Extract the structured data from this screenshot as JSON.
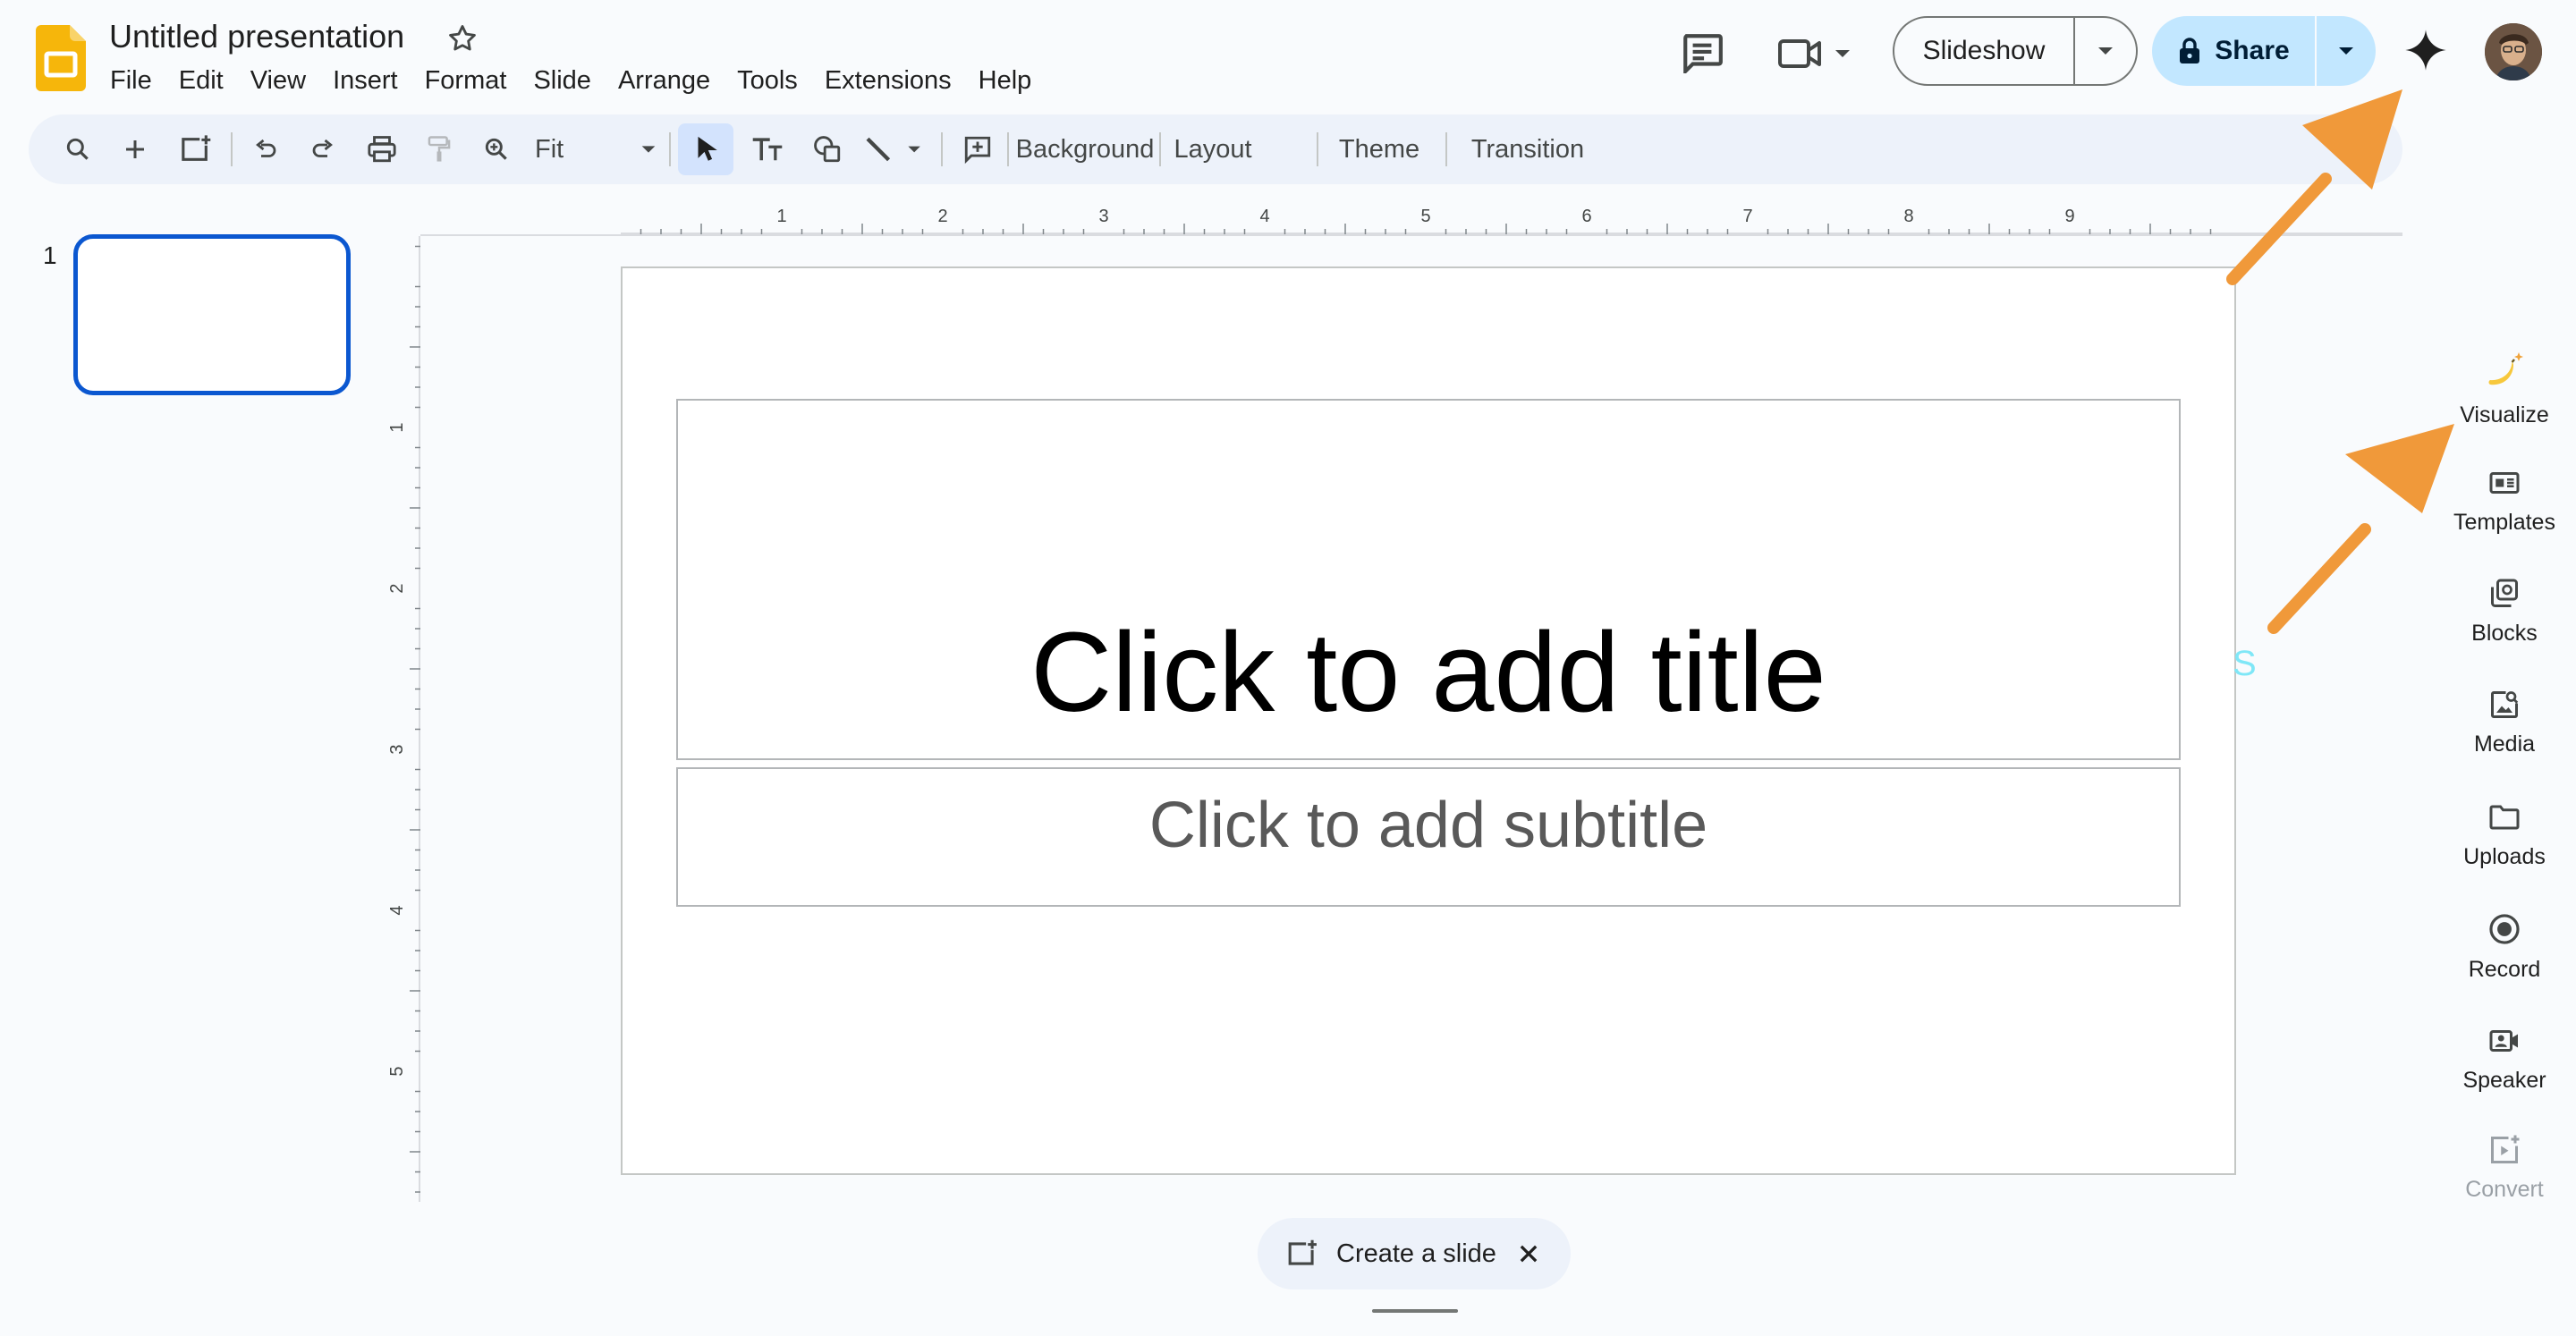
{
  "app": {
    "doc_title": "Untitled presentation",
    "menu": [
      "File",
      "Edit",
      "View",
      "Insert",
      "Format",
      "Slide",
      "Arrange",
      "Tools",
      "Extensions",
      "Help"
    ]
  },
  "header": {
    "slideshow_label": "Slideshow",
    "share_label": "Share"
  },
  "toolbar": {
    "zoom_value": "Fit",
    "background_label": "Background",
    "layout_label": "Layout",
    "theme_label": "Theme",
    "transition_label": "Transition"
  },
  "filmstrip": {
    "slide_number": "1"
  },
  "rulers": {
    "horizontal_labels": [
      "1",
      "2",
      "3",
      "4",
      "5",
      "6",
      "7",
      "8",
      "9"
    ],
    "vertical_labels": [
      "1",
      "2",
      "3",
      "4",
      "5"
    ]
  },
  "slide": {
    "title_placeholder": "Click to add title",
    "subtitle_placeholder": "Click to add subtitle",
    "stray_char": "S"
  },
  "side_panel": {
    "items": [
      {
        "label": "Visualize",
        "icon": "banana-sparkle-icon"
      },
      {
        "label": "Templates",
        "icon": "templates-icon"
      },
      {
        "label": "Blocks",
        "icon": "blocks-icon"
      },
      {
        "label": "Media",
        "icon": "media-icon"
      },
      {
        "label": "Uploads",
        "icon": "folder-icon"
      },
      {
        "label": "Record",
        "icon": "record-icon"
      },
      {
        "label": "Speaker",
        "icon": "speaker-camera-icon"
      },
      {
        "label": "Convert",
        "icon": "convert-icon",
        "disabled": true
      }
    ]
  },
  "bottom": {
    "create_slide_label": "Create a slide"
  },
  "colors": {
    "accent_blue": "#0b57d0",
    "share_bg": "#c2e7ff",
    "toolbar_bg": "#edf2fa",
    "annotation_orange": "#f0993a",
    "slides_logo_yellow": "#f6b60b"
  }
}
